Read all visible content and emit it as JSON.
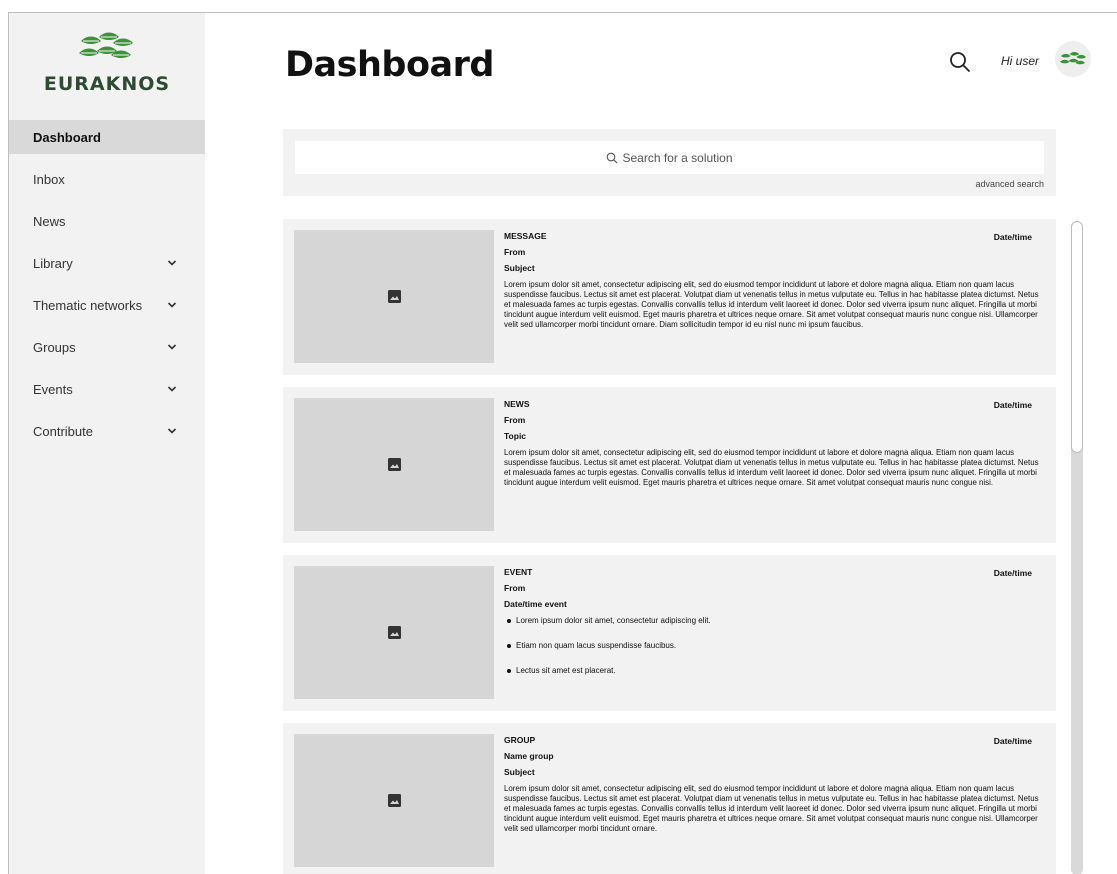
{
  "brand": {
    "name": "EURAKNOS",
    "color": "#2d4a33",
    "leaf_color": "#3f8f3b"
  },
  "sidebar": {
    "items": [
      {
        "label": "Dashboard",
        "active": true,
        "expandable": false
      },
      {
        "label": "Inbox",
        "active": false,
        "expandable": false
      },
      {
        "label": "News",
        "active": false,
        "expandable": false
      },
      {
        "label": "Library",
        "active": false,
        "expandable": true
      },
      {
        "label": "Thematic networks",
        "active": false,
        "expandable": true
      },
      {
        "label": "Groups",
        "active": false,
        "expandable": true
      },
      {
        "label": "Events",
        "active": false,
        "expandable": true
      },
      {
        "label": "Contribute",
        "active": false,
        "expandable": true
      }
    ]
  },
  "header": {
    "title": "Dashboard",
    "greeting": "Hi user",
    "search_icon": "search-icon"
  },
  "search": {
    "placeholder": "Search for a solution",
    "advanced_label": "advanced search"
  },
  "cards": [
    {
      "type": "MESSAGE",
      "date": "Date/time",
      "line1": "From",
      "line2": "Subject",
      "text": "Lorem ipsum dolor sit amet, consectetur adipiscing elit, sed do eiusmod tempor incididunt ut labore et dolore magna aliqua. Etiam non quam lacus suspendisse faucibus. Lectus sit amet est placerat. Volutpat diam ut venenatis tellus in metus vulputate eu. Tellus in hac habitasse platea dictumst. Netus et malesuada fames ac turpis egestas. Convallis convallis tellus id interdum velit laoreet id donec. Dolor sed viverra ipsum nunc aliquet. Fringilla ut morbi tincidunt augue interdum velit euismod. Eget mauris pharetra et ultrices neque ornare. Sit amet volutpat consequat mauris nunc congue nisi. Ullamcorper velit sed ullamcorper morbi tincidunt ornare. Diam sollicitudin tempor id eu nisl nunc mi ipsum faucibus."
    },
    {
      "type": "NEWS",
      "date": "Date/time",
      "line1": "From",
      "line2": "Topic",
      "text": "Lorem ipsum dolor sit amet, consectetur adipiscing elit, sed do eiusmod tempor incididunt ut labore et dolore magna aliqua. Etiam non quam lacus suspendisse faucibus. Lectus sit amet est placerat. Volutpat diam ut venenatis tellus in metus vulputate eu. Tellus in hac habitasse platea dictumst. Netus et malesuada fames ac turpis egestas. Convallis convallis tellus id interdum velit laoreet id donec. Dolor sed viverra ipsum nunc aliquet. Fringilla ut morbi tincidunt augue interdum velit euismod. Eget mauris pharetra et ultrices neque ornare. Sit amet volutpat consequat mauris nunc congue nisi."
    },
    {
      "type": "EVENT",
      "date": "Date/time",
      "line1": "From",
      "line2": "Date/time event",
      "bullets": [
        "Lorem ipsum dolor sit amet, consectetur adipiscing elit.",
        "Etiam non quam lacus suspendisse faucibus.",
        "Lectus sit amet est placerat."
      ]
    },
    {
      "type": "GROUP",
      "date": "Date/time",
      "line1": "Name group",
      "line2": "Subject",
      "text": "Lorem ipsum dolor sit amet, consectetur adipiscing elit, sed do eiusmod tempor incididunt ut labore et dolore magna aliqua. Etiam non quam lacus suspendisse faucibus. Lectus sit amet est placerat. Volutpat diam ut venenatis tellus in metus vulputate eu. Tellus in hac habitasse platea dictumst. Netus et malesuada fames ac turpis egestas. Convallis convallis tellus id interdum velit laoreet id donec. Dolor sed viverra ipsum nunc aliquet. Fringilla ut morbi tincidunt augue interdum velit euismod. Eget mauris pharetra et ultrices neque ornare. Sit amet volutpat consequat mauris nunc congue nisi. Ullamcorper velit sed ullamcorper morbi tincidunt ornare."
    }
  ]
}
